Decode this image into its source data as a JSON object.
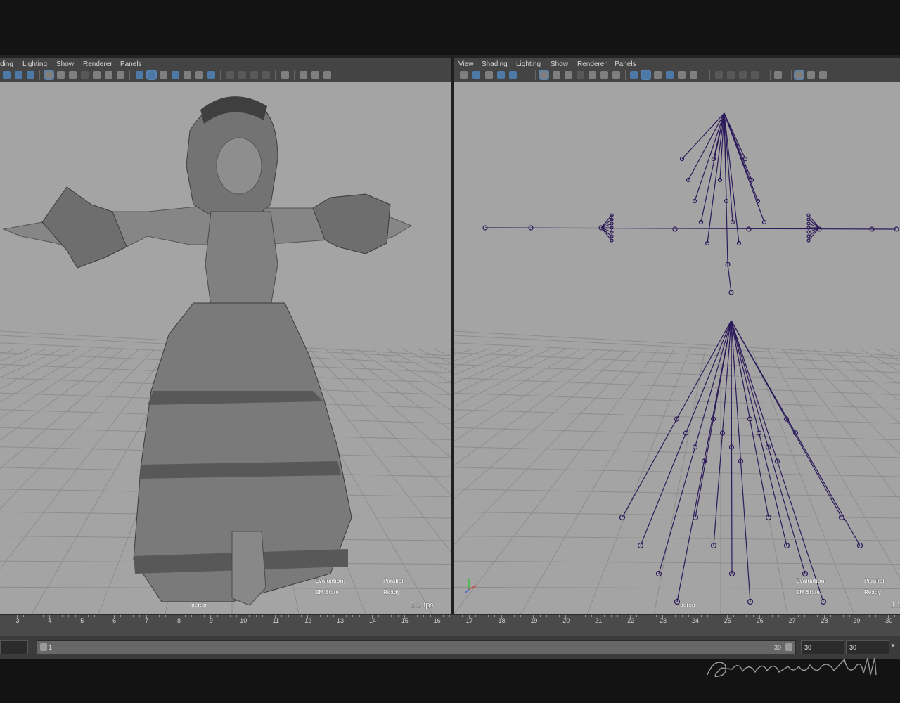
{
  "left_panel": {
    "menu": [
      "ding",
      "Lighting",
      "Show",
      "Renderer",
      "Panels"
    ],
    "camera": "persp",
    "hud": {
      "evaluation_label": "Evaluation:",
      "evaluation_value": "Parallel",
      "em_label": "EM State:",
      "em_value": "Ready"
    },
    "fps": "1.2 fps"
  },
  "right_panel": {
    "menu": [
      "View",
      "Shading",
      "Lighting",
      "Show",
      "Renderer",
      "Panels"
    ],
    "camera": "persp",
    "hud": {
      "evaluation_label": "Evaluation:",
      "evaluation_value": "Parallel",
      "em_label": "EM State:",
      "em_value": "Ready"
    },
    "fps": "1.2"
  },
  "timeline": {
    "ticks": [
      "3",
      "4",
      "5",
      "6",
      "7",
      "8",
      "9",
      "10",
      "11",
      "12",
      "13",
      "14",
      "15",
      "16",
      "17",
      "18",
      "19",
      "20",
      "21",
      "22",
      "23",
      "24",
      "25",
      "26",
      "27",
      "28",
      "29",
      "30"
    ]
  },
  "range": {
    "start": "1",
    "slider_end": "30",
    "end": "30",
    "anim_end": "30"
  },
  "watermark": "Gongonsince2011",
  "colors": {
    "viewport_bg": "#a4a4a4",
    "grid": "#8d8d8d",
    "joint": "#2c1a5a",
    "selection_blue": "#5a8fc8"
  }
}
